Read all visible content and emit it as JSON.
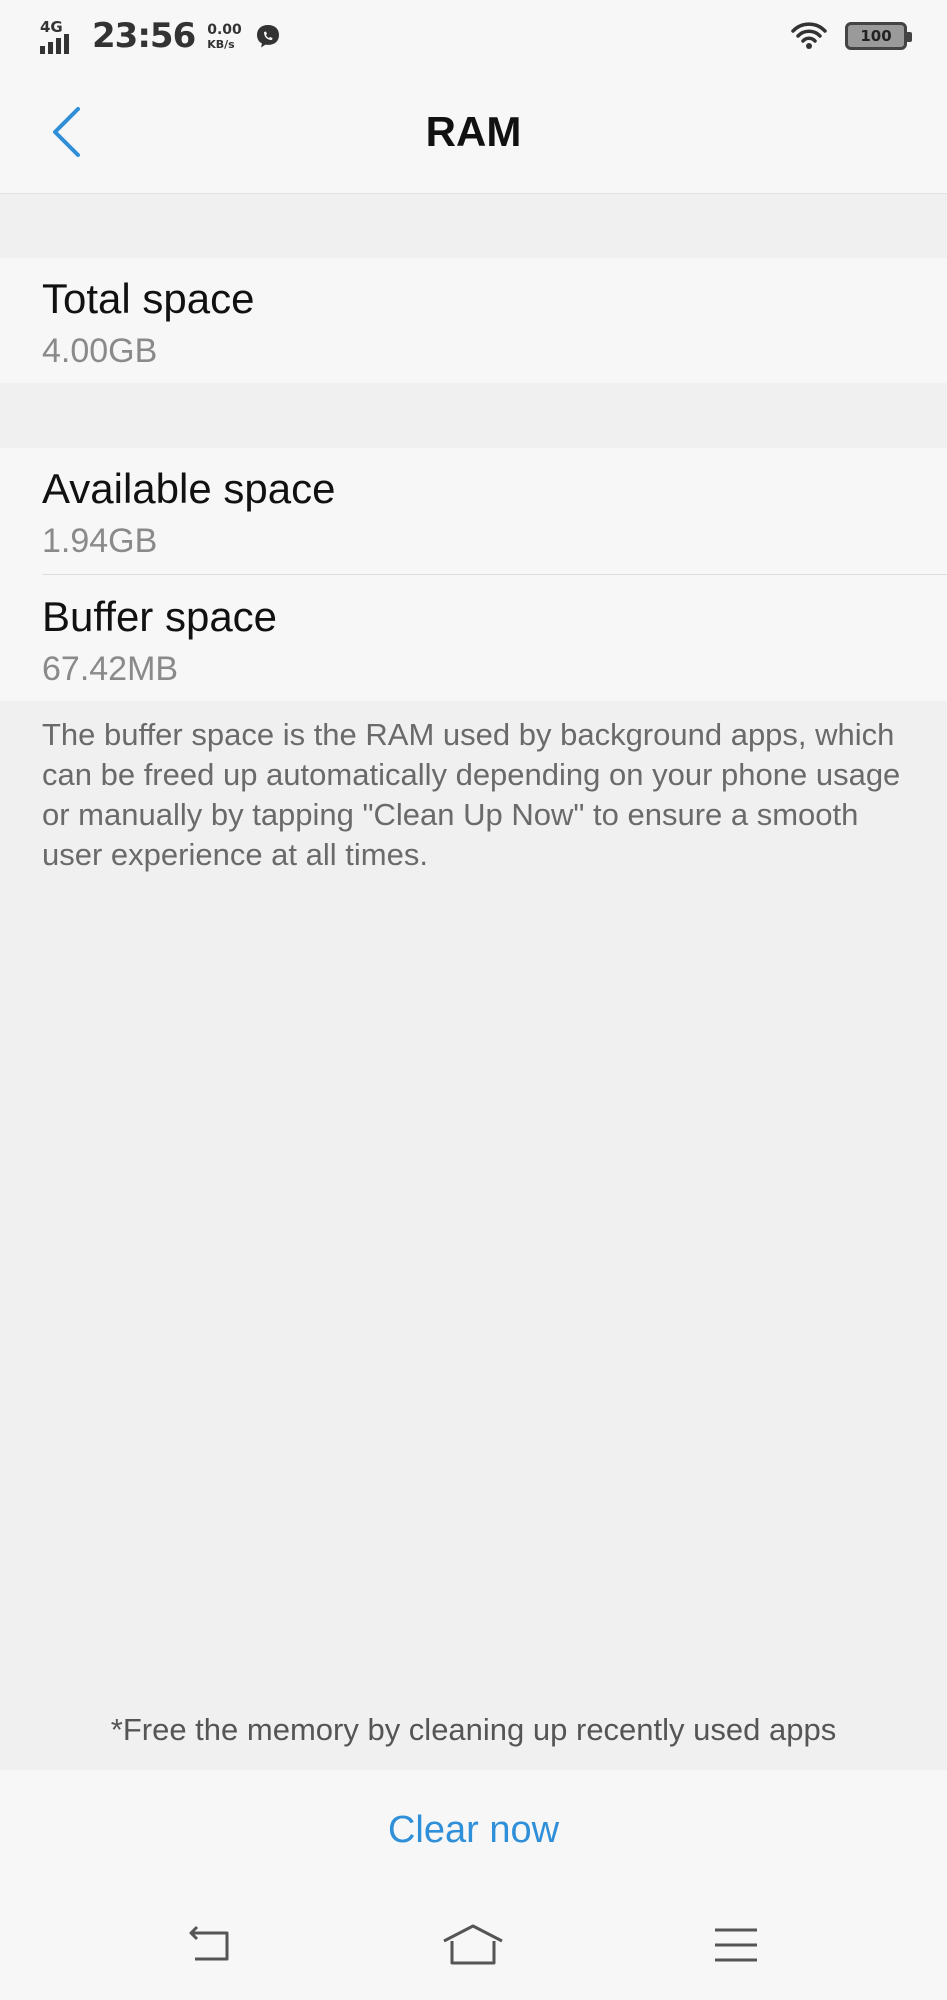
{
  "status_bar": {
    "network_type": "4G",
    "time": "23:56",
    "net_speed_value": "0.00",
    "net_speed_unit": "KB/s",
    "battery_level": "100"
  },
  "header": {
    "title": "RAM"
  },
  "total": {
    "label": "Total space",
    "value": "4.00GB"
  },
  "available": {
    "label": "Available space",
    "value": "1.94GB"
  },
  "buffer": {
    "label": "Buffer space",
    "value": "67.42MB"
  },
  "note": "The buffer space is the RAM used by background apps, which can be freed up automatically depending on your phone usage or manually by tapping \"Clean Up Now\" to ensure a smooth user experience at all times.",
  "footer_note": "*Free the memory by cleaning up recently used apps",
  "action": {
    "clear_label": "Clear now"
  },
  "colors": {
    "accent": "#2f8fd8",
    "background": "#f0f0f0",
    "surface": "#f7f7f7"
  },
  "icons": {
    "back": "chevron-left-icon",
    "nav_back": "nav-back-icon",
    "nav_home": "nav-home-icon",
    "nav_menu": "nav-menu-icon",
    "wifi": "wifi-icon",
    "message": "message-icon"
  }
}
